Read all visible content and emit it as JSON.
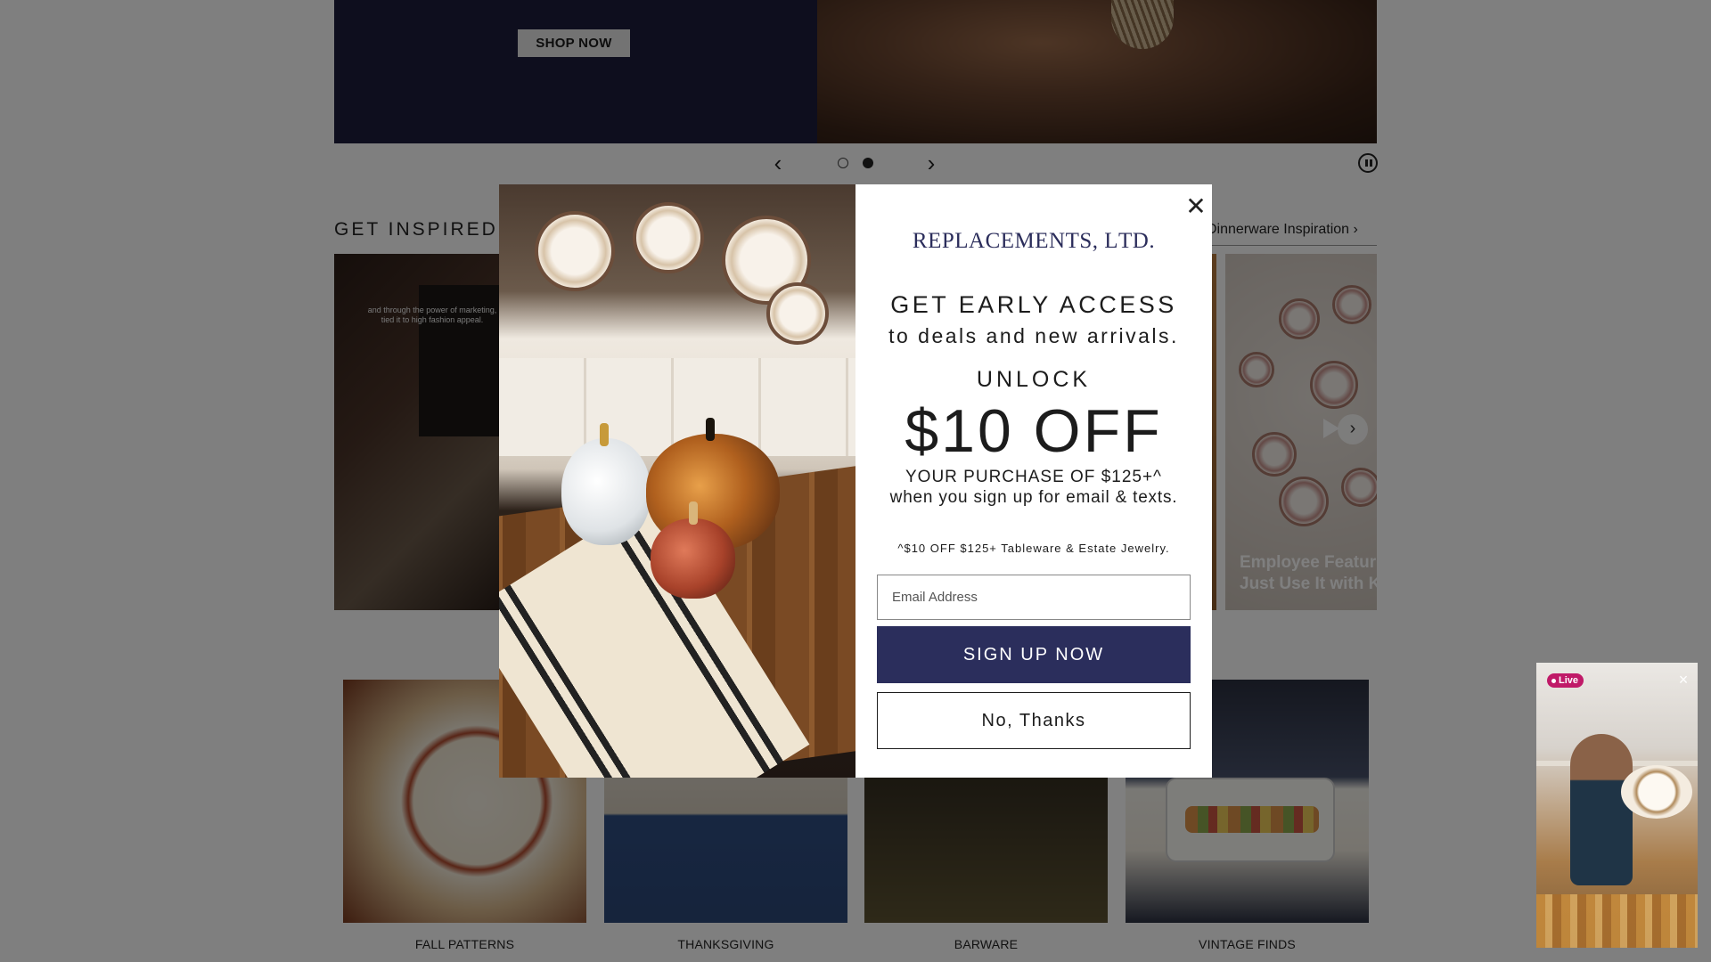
{
  "hero": {
    "shop_now_label": "SHOP NOW"
  },
  "carousel": {
    "prev_icon": "chevron-left-icon",
    "next_icon": "chevron-right-icon",
    "pause_icon": "pause-icon",
    "slide_count": 2,
    "active_slide": 2
  },
  "inspired": {
    "title": "GET INSPIRED",
    "see_link": "Dinnerware Inspiration",
    "tiles": [
      {
        "caption": "and through the power of marketing, tied it to high fashion appeal."
      },
      {
        "caption": "Employee Feature Just Use It with K"
      }
    ],
    "tile_caption_lines": [
      "Employee Featur",
      "Just Use It with K"
    ]
  },
  "categories": [
    {
      "label": "FALL PATTERNS"
    },
    {
      "label": "THANKSGIVING"
    },
    {
      "label": "BARWARE"
    },
    {
      "label": "VINTAGE FINDS"
    }
  ],
  "live_widget": {
    "badge": "Live",
    "close_icon": "close-icon"
  },
  "modal": {
    "brand_first": "R",
    "brand_rest": "EPLACEMENTS",
    "brand_suffix": ", L",
    "brand_ltd": "TD",
    "brand_dot": ".",
    "headline": "GET EARLY ACCESS",
    "subheadline": "to deals and new arrivals.",
    "unlock": "UNLOCK",
    "offer": "$10 OFF",
    "purchase": "YOUR PURCHASE OF $125+^",
    "signup_msg": "when you sign up for email & texts.",
    "fine_print": "^$10 OFF $125+ Tableware & Estate Jewelry.",
    "email_placeholder": "Email Address",
    "email_value": "",
    "signup_button": "SIGN UP NOW",
    "no_thanks_button": "No, Thanks",
    "close_glyph": "✕"
  },
  "colors": {
    "brand_navy": "#2b2e5c",
    "overlay": "rgba(0,0,0,0.5)",
    "live_badge": "#c01a68"
  }
}
